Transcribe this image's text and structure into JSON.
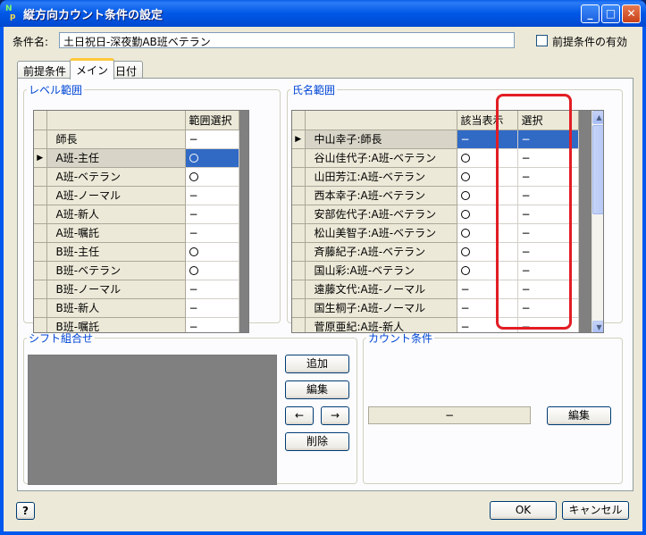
{
  "window": {
    "title": "縦方向カウント条件の設定",
    "icon": "np-app-icon",
    "min_glyph": "_",
    "max_glyph": "□",
    "close_glyph": "✕"
  },
  "condition": {
    "label": "条件名:",
    "value": "土日祝日-深夜勤AB班ベテラン",
    "prereq_enable_label": "前提条件の有効",
    "prereq_enable_checked": false
  },
  "tabs": [
    "前提条件",
    "メイン",
    "日付"
  ],
  "active_tab": "メイン",
  "level_range": {
    "title": "レベル範囲",
    "column": "範囲選択",
    "current_row_marker": "▶",
    "rows": [
      {
        "name": "師長",
        "sel": "−"
      },
      {
        "name": "A班-主任",
        "sel": "○"
      },
      {
        "name": "A班-ベテラン",
        "sel": "○"
      },
      {
        "name": "A班-ノーマル",
        "sel": "−"
      },
      {
        "name": "A班-新人",
        "sel": "−"
      },
      {
        "name": "A班-嘱託",
        "sel": "−"
      },
      {
        "name": "B班-主任",
        "sel": "○"
      },
      {
        "name": "B班-ベテラン",
        "sel": "○"
      },
      {
        "name": "B班-ノーマル",
        "sel": "−"
      },
      {
        "name": "B班-新人",
        "sel": "−"
      },
      {
        "name": "B班-嘱託",
        "sel": "−"
      }
    ]
  },
  "name_range": {
    "title": "氏名範囲",
    "columns": [
      "該当表示",
      "選択"
    ],
    "current_row_marker": "▶",
    "rows": [
      {
        "name": "中山幸子:師長",
        "show": "−",
        "sel": "−"
      },
      {
        "name": "谷山佳代子:A班-ベテラン",
        "show": "○",
        "sel": "−"
      },
      {
        "name": "山田芳江:A班-ベテラン",
        "show": "○",
        "sel": "−"
      },
      {
        "name": "西本幸子:A班-ベテラン",
        "show": "○",
        "sel": "−"
      },
      {
        "name": "安部佐代子:A班-ベテラン",
        "show": "○",
        "sel": "−"
      },
      {
        "name": "松山美智子:A班-ベテラン",
        "show": "○",
        "sel": "−"
      },
      {
        "name": "斉藤紀子:A班-ベテラン",
        "show": "○",
        "sel": "−"
      },
      {
        "name": "国山彩:A班-ベテラン",
        "show": "○",
        "sel": "−"
      },
      {
        "name": "遠藤文代:A班-ノーマル",
        "show": "−",
        "sel": "−"
      },
      {
        "name": "国生桐子:A班-ノーマル",
        "show": "−",
        "sel": "−"
      },
      {
        "name": "菅原亜紀:A班-新人",
        "show": "−",
        "sel": "−"
      }
    ],
    "scroll_up": "▲",
    "scroll_down": "▼"
  },
  "shift_combo": {
    "title": "シフト組合せ",
    "add": "追加",
    "edit": "編集",
    "left": "←",
    "right": "→",
    "delete": "削除"
  },
  "count_condition": {
    "title": "カウント条件",
    "value": "−",
    "edit": "編集"
  },
  "footer": {
    "help": "?",
    "ok": "OK",
    "cancel": "キャンセル"
  },
  "colors": {
    "selection": "#316ac5",
    "highlight_box": "#e21d25",
    "legend": "#0046d5",
    "titlebar": "#0058e6"
  }
}
